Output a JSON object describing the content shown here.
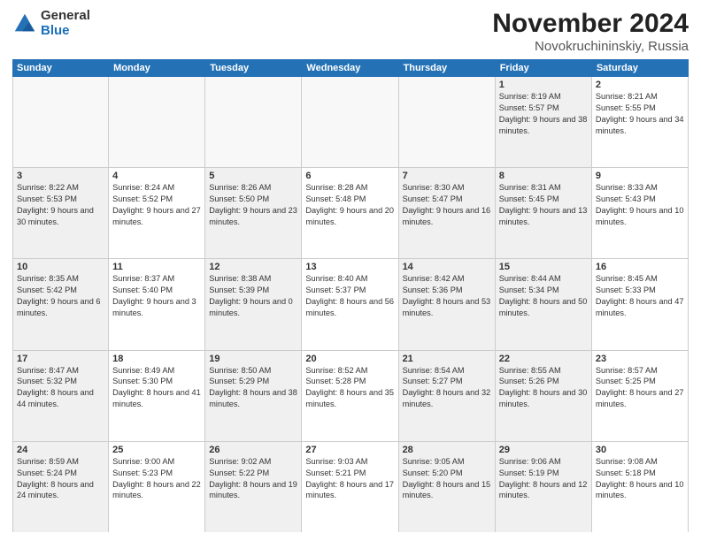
{
  "logo": {
    "general": "General",
    "blue": "Blue"
  },
  "title": {
    "month": "November 2024",
    "location": "Novokruchininskiy, Russia"
  },
  "weekdays": [
    "Sunday",
    "Monday",
    "Tuesday",
    "Wednesday",
    "Thursday",
    "Friday",
    "Saturday"
  ],
  "weeks": [
    [
      {
        "day": "",
        "info": "",
        "empty": true
      },
      {
        "day": "",
        "info": "",
        "empty": true
      },
      {
        "day": "",
        "info": "",
        "empty": true
      },
      {
        "day": "",
        "info": "",
        "empty": true
      },
      {
        "day": "",
        "info": "",
        "empty": true
      },
      {
        "day": "1",
        "info": "Sunrise: 8:19 AM\nSunset: 5:57 PM\nDaylight: 9 hours and 38 minutes.",
        "shaded": true
      },
      {
        "day": "2",
        "info": "Sunrise: 8:21 AM\nSunset: 5:55 PM\nDaylight: 9 hours and 34 minutes."
      }
    ],
    [
      {
        "day": "3",
        "info": "Sunrise: 8:22 AM\nSunset: 5:53 PM\nDaylight: 9 hours and 30 minutes.",
        "shaded": true
      },
      {
        "day": "4",
        "info": "Sunrise: 8:24 AM\nSunset: 5:52 PM\nDaylight: 9 hours and 27 minutes."
      },
      {
        "day": "5",
        "info": "Sunrise: 8:26 AM\nSunset: 5:50 PM\nDaylight: 9 hours and 23 minutes.",
        "shaded": true
      },
      {
        "day": "6",
        "info": "Sunrise: 8:28 AM\nSunset: 5:48 PM\nDaylight: 9 hours and 20 minutes."
      },
      {
        "day": "7",
        "info": "Sunrise: 8:30 AM\nSunset: 5:47 PM\nDaylight: 9 hours and 16 minutes.",
        "shaded": true
      },
      {
        "day": "8",
        "info": "Sunrise: 8:31 AM\nSunset: 5:45 PM\nDaylight: 9 hours and 13 minutes.",
        "shaded": true
      },
      {
        "day": "9",
        "info": "Sunrise: 8:33 AM\nSunset: 5:43 PM\nDaylight: 9 hours and 10 minutes."
      }
    ],
    [
      {
        "day": "10",
        "info": "Sunrise: 8:35 AM\nSunset: 5:42 PM\nDaylight: 9 hours and 6 minutes.",
        "shaded": true
      },
      {
        "day": "11",
        "info": "Sunrise: 8:37 AM\nSunset: 5:40 PM\nDaylight: 9 hours and 3 minutes."
      },
      {
        "day": "12",
        "info": "Sunrise: 8:38 AM\nSunset: 5:39 PM\nDaylight: 9 hours and 0 minutes.",
        "shaded": true
      },
      {
        "day": "13",
        "info": "Sunrise: 8:40 AM\nSunset: 5:37 PM\nDaylight: 8 hours and 56 minutes."
      },
      {
        "day": "14",
        "info": "Sunrise: 8:42 AM\nSunset: 5:36 PM\nDaylight: 8 hours and 53 minutes.",
        "shaded": true
      },
      {
        "day": "15",
        "info": "Sunrise: 8:44 AM\nSunset: 5:34 PM\nDaylight: 8 hours and 50 minutes.",
        "shaded": true
      },
      {
        "day": "16",
        "info": "Sunrise: 8:45 AM\nSunset: 5:33 PM\nDaylight: 8 hours and 47 minutes."
      }
    ],
    [
      {
        "day": "17",
        "info": "Sunrise: 8:47 AM\nSunset: 5:32 PM\nDaylight: 8 hours and 44 minutes.",
        "shaded": true
      },
      {
        "day": "18",
        "info": "Sunrise: 8:49 AM\nSunset: 5:30 PM\nDaylight: 8 hours and 41 minutes."
      },
      {
        "day": "19",
        "info": "Sunrise: 8:50 AM\nSunset: 5:29 PM\nDaylight: 8 hours and 38 minutes.",
        "shaded": true
      },
      {
        "day": "20",
        "info": "Sunrise: 8:52 AM\nSunset: 5:28 PM\nDaylight: 8 hours and 35 minutes."
      },
      {
        "day": "21",
        "info": "Sunrise: 8:54 AM\nSunset: 5:27 PM\nDaylight: 8 hours and 32 minutes.",
        "shaded": true
      },
      {
        "day": "22",
        "info": "Sunrise: 8:55 AM\nSunset: 5:26 PM\nDaylight: 8 hours and 30 minutes.",
        "shaded": true
      },
      {
        "day": "23",
        "info": "Sunrise: 8:57 AM\nSunset: 5:25 PM\nDaylight: 8 hours and 27 minutes."
      }
    ],
    [
      {
        "day": "24",
        "info": "Sunrise: 8:59 AM\nSunset: 5:24 PM\nDaylight: 8 hours and 24 minutes.",
        "shaded": true
      },
      {
        "day": "25",
        "info": "Sunrise: 9:00 AM\nSunset: 5:23 PM\nDaylight: 8 hours and 22 minutes."
      },
      {
        "day": "26",
        "info": "Sunrise: 9:02 AM\nSunset: 5:22 PM\nDaylight: 8 hours and 19 minutes.",
        "shaded": true
      },
      {
        "day": "27",
        "info": "Sunrise: 9:03 AM\nSunset: 5:21 PM\nDaylight: 8 hours and 17 minutes."
      },
      {
        "day": "28",
        "info": "Sunrise: 9:05 AM\nSunset: 5:20 PM\nDaylight: 8 hours and 15 minutes.",
        "shaded": true
      },
      {
        "day": "29",
        "info": "Sunrise: 9:06 AM\nSunset: 5:19 PM\nDaylight: 8 hours and 12 minutes.",
        "shaded": true
      },
      {
        "day": "30",
        "info": "Sunrise: 9:08 AM\nSunset: 5:18 PM\nDaylight: 8 hours and 10 minutes."
      }
    ]
  ]
}
